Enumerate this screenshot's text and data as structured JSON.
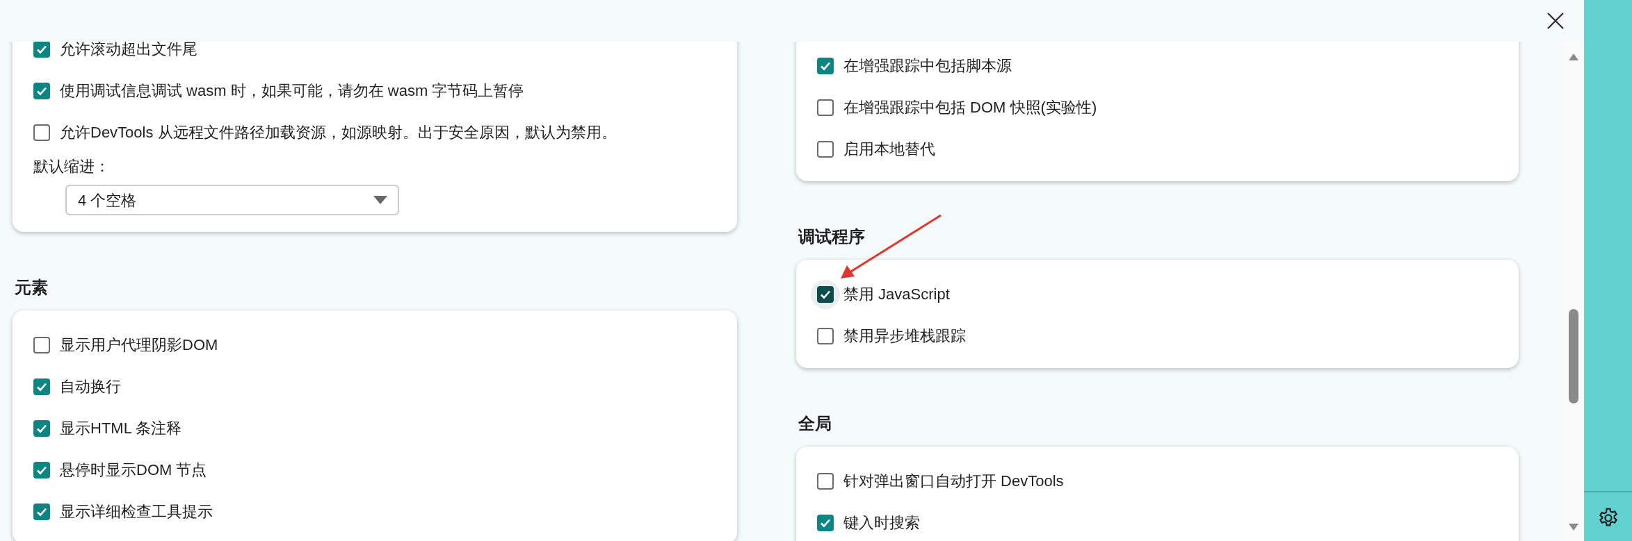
{
  "columns": [
    {
      "sections": [
        {
          "items": [
            {
              "kind": "checkbox",
              "label": "允许滚动超出文件尾",
              "checked": true,
              "focused": false
            },
            {
              "kind": "checkbox",
              "label": "使用调试信息调试 wasm 时，如果可能，请勿在 wasm 字节码上暂停",
              "checked": true,
              "focused": false
            },
            {
              "kind": "checkbox",
              "label": "允许DevTools 从远程文件路径加载资源，如源映射。出于安全原因，默认为禁用。",
              "checked": false,
              "focused": false
            },
            {
              "kind": "select",
              "label": "默认缩进：",
              "value": "4 个空格"
            }
          ]
        },
        {
          "title": "元素",
          "items": [
            {
              "kind": "checkbox",
              "label": "显示用户代理阴影DOM",
              "checked": false,
              "focused": false
            },
            {
              "kind": "checkbox",
              "label": "自动换行",
              "checked": true,
              "focused": false
            },
            {
              "kind": "checkbox",
              "label": "显示HTML 条注释",
              "checked": true,
              "focused": false
            },
            {
              "kind": "checkbox",
              "label": "悬停时显示DOM 节点",
              "checked": true,
              "focused": false
            },
            {
              "kind": "checkbox",
              "label": "显示详细检查工具提示",
              "checked": true,
              "focused": false
            }
          ]
        }
      ]
    },
    {
      "sections": [
        {
          "items": [
            {
              "kind": "checkbox",
              "label": "在增强跟踪中包括脚本源",
              "checked": true,
              "focused": false
            },
            {
              "kind": "checkbox",
              "label": "在增强跟踪中包括 DOM 快照(实验性)",
              "checked": false,
              "focused": false
            },
            {
              "kind": "checkbox",
              "label": "启用本地替代",
              "checked": false,
              "focused": false
            }
          ]
        },
        {
          "title": "调试程序",
          "items": [
            {
              "kind": "checkbox",
              "label": "禁用 JavaScript",
              "checked": true,
              "focused": true
            },
            {
              "kind": "checkbox",
              "label": "禁用异步堆栈跟踪",
              "checked": false,
              "focused": false
            }
          ]
        },
        {
          "title": "全局",
          "items": [
            {
              "kind": "checkbox",
              "label": "针对弹出窗口自动打开 DevTools",
              "checked": false,
              "focused": false
            },
            {
              "kind": "checkbox",
              "label": "键入时搜索",
              "checked": true,
              "focused": false
            }
          ]
        }
      ]
    }
  ],
  "annotations": [
    {
      "kind": "arrow"
    }
  ]
}
